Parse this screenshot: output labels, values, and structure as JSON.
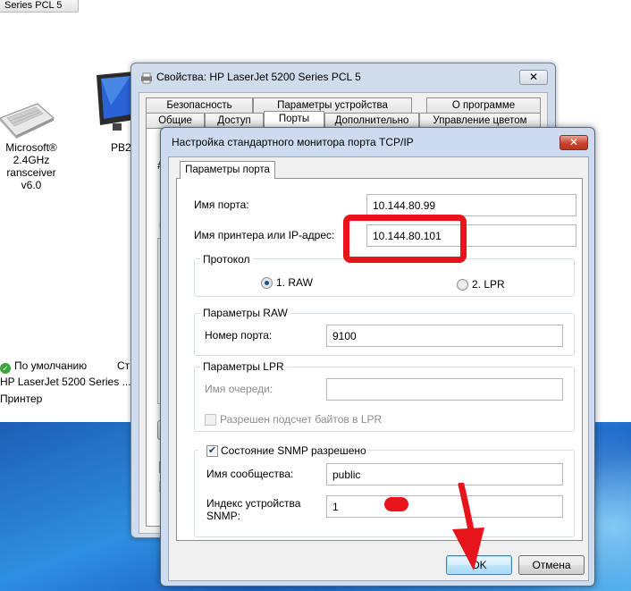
{
  "explorer": {
    "top_button": "Series PCL 5",
    "device_keyboard_label": [
      "Microsoft®",
      "2.4GHz",
      "ransceiver v6.0"
    ],
    "device_monitor_label": "PB2",
    "status_default": "По умолчанию",
    "status_col": "Ст",
    "printer_name": "HP LaserJet 5200 Series ...",
    "printer_type": "Принтер"
  },
  "props_window": {
    "title": "Свойства: HP LaserJet 5200 Series PCL 5",
    "close": "✕",
    "tabs_row1": [
      "Безопасность",
      "Параметры устройства",
      "О программе"
    ],
    "tabs_row2": [
      "Общие",
      "Доступ",
      "Порты",
      "Дополнительно",
      "Управление цветом"
    ],
    "left_fragments": [
      "#",
      "В",
      "н"
    ]
  },
  "tcp_dialog": {
    "title": "Настройка стандартного монитора порта TCP/IP",
    "close": "✕",
    "tab": "Параметры порта",
    "port_name_label": "Имя порта:",
    "port_name_value": "10.144.80.99",
    "printer_ip_label": "Имя принтера или IP-адрес:",
    "printer_ip_value": "10.144.80.101",
    "protocol": {
      "title": "Протокол",
      "raw": "1. RAW",
      "lpr": "2. LPR",
      "selected": "1. RAW"
    },
    "raw_settings": {
      "title": "Параметры RAW",
      "port_number_label": "Номер порта:",
      "port_number_value": "9100"
    },
    "lpr_settings": {
      "title": "Параметры LPR",
      "queue_label": "Имя очереди:",
      "queue_value": "",
      "byte_count_label": "Разрешен подсчет байтов в LPR",
      "byte_count_checked": false
    },
    "snmp": {
      "enabled_label": "Состояние SNMP разрешено",
      "enabled_checked": true,
      "community_label": "Имя сообщества:",
      "community_value": "public",
      "device_index_label_1": "Индекс устройства",
      "device_index_label_2": "SNMP:",
      "device_index_value": "1"
    },
    "ok_button": "OK",
    "cancel_button": "Отмена"
  },
  "colors": {
    "annotation_red": "#e8141b",
    "dialog_frame": "#cddbee"
  }
}
